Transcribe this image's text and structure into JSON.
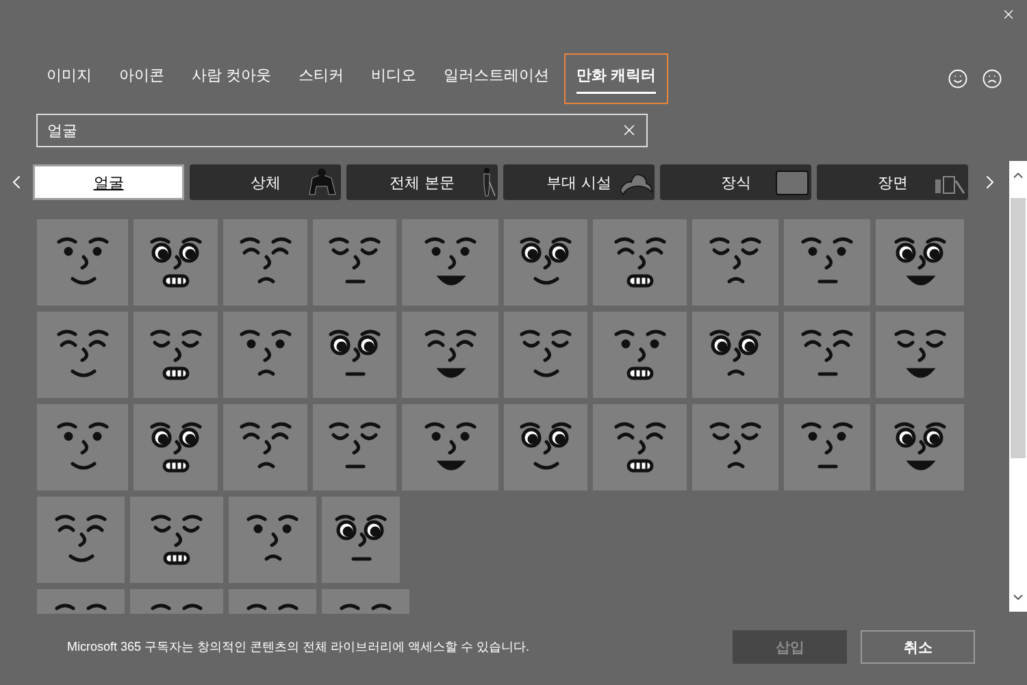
{
  "tabs": [
    {
      "label": "이미지",
      "selected": false
    },
    {
      "label": "아이콘",
      "selected": false
    },
    {
      "label": "사람 컷아웃",
      "selected": false
    },
    {
      "label": "스티커",
      "selected": false
    },
    {
      "label": "비디오",
      "selected": false
    },
    {
      "label": "일러스트레이션",
      "selected": false
    },
    {
      "label": "만화 캐릭터",
      "selected": true
    }
  ],
  "search": {
    "value": "얼굴"
  },
  "categories": [
    {
      "label": "얼굴",
      "selected": true
    },
    {
      "label": "상체",
      "selected": false
    },
    {
      "label": "전체 본문",
      "selected": false
    },
    {
      "label": "부대 시설",
      "selected": false
    },
    {
      "label": "장식",
      "selected": false
    },
    {
      "label": "장면",
      "selected": false
    }
  ],
  "footer": {
    "notice": "Microsoft 365 구독자는 창의적인 콘텐츠의 전체 라이브러리에 액세스할 수 있습니다.",
    "buttons": [
      {
        "label": "삽입",
        "disabled": true
      },
      {
        "label": "취소",
        "disabled": false
      }
    ]
  }
}
